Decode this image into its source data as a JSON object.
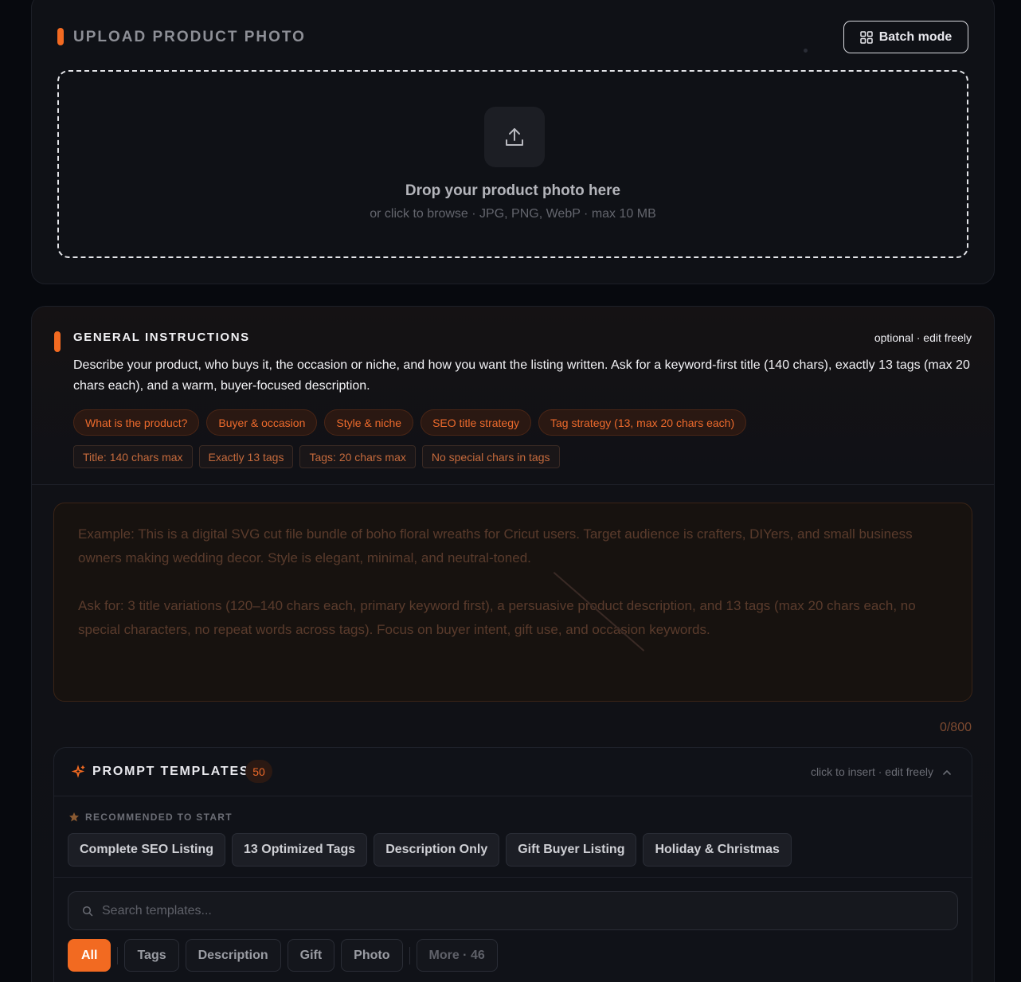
{
  "upload": {
    "title": "UPLOAD PRODUCT PHOTO",
    "batch_label": "Batch mode",
    "drop_title": "Drop your product photo here",
    "drop_sub": "or click to browse · JPG, PNG, WebP · max 10 MB",
    "upload_icon": "upload-icon",
    "batch_icon": "grid-icon"
  },
  "instructions": {
    "title": "GENERAL INSTRUCTIONS",
    "optional": "optional · edit freely",
    "description": "Describe your product, who buys it, the occasion or niche, and how you want the listing written. Ask for a keyword-first title (140 chars), exactly 13 tags (max 20 chars each), and a warm, buyer-focused description.",
    "pills": [
      "What is the product?",
      "Buyer & occasion",
      "Style & niche",
      "SEO title strategy",
      "Tag strategy (13, max 20 chars each)"
    ],
    "tags": [
      "Title: 140 chars max",
      "Exactly 13 tags",
      "Tags: 20 chars max",
      "No special chars in tags"
    ],
    "example_p1": "Example: This is a digital SVG cut file bundle of boho floral wreaths for Cricut users. Target audience is crafters, DIYers, and small business owners making wedding decor. Style is elegant, minimal, and neutral-toned.",
    "example_p2": "Ask for: 3 title variations (120–140 chars each, primary keyword first), a persuasive product description, and 13 tags (max 20 chars each, no special characters, no repeat words across tags). Focus on buyer intent, gift use, and occasion keywords.",
    "char_count": "0/800"
  },
  "templates": {
    "title": "PROMPT TEMPLATES",
    "count": "50",
    "hint": "click to insert · edit freely",
    "recommended_label": "RECOMMENDED TO START",
    "recommended": [
      "Complete SEO Listing",
      "13 Optimized Tags",
      "Description Only",
      "Gift Buyer Listing",
      "Holiday & Christmas"
    ],
    "search_placeholder": "Search templates...",
    "filters": {
      "all": "All",
      "tags": "Tags",
      "description": "Description",
      "gift": "Gift",
      "photo": "Photo",
      "more": "More · 46"
    }
  },
  "colors": {
    "accent": "#f26a21",
    "background": "#07090e",
    "card": "#0f1116"
  }
}
